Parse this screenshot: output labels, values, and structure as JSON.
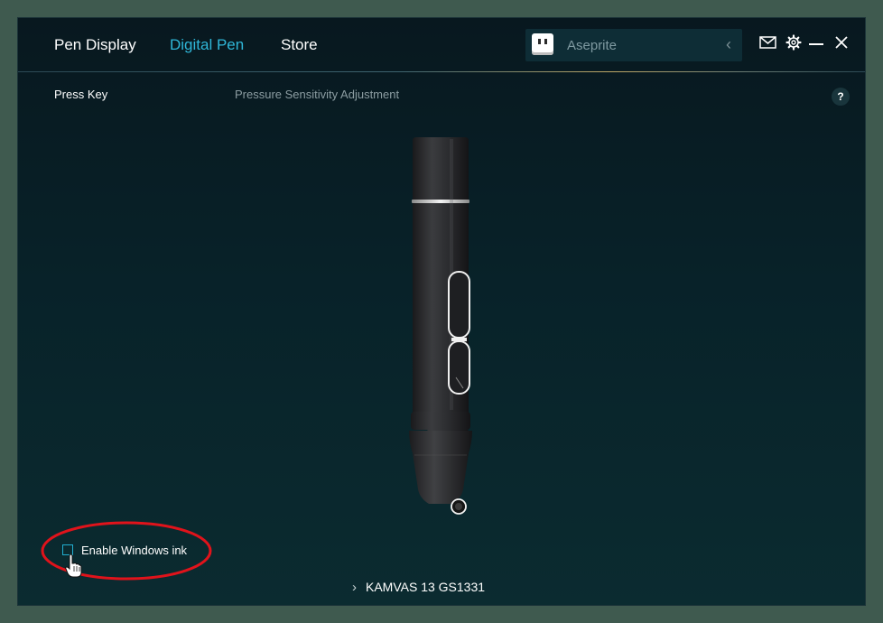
{
  "nav": {
    "tabs": [
      {
        "label": "Pen Display",
        "active": false
      },
      {
        "label": "Digital Pen",
        "active": true
      },
      {
        "label": "Store",
        "active": false
      }
    ]
  },
  "app_selector": {
    "value": "Aseprite",
    "icon": "aseprite-app-icon",
    "chevron": "‹"
  },
  "window_controls": [
    "mail-icon",
    "gear-icon",
    "minimize-icon",
    "close-icon"
  ],
  "subtabs": [
    {
      "label": "Press Key",
      "active": true
    },
    {
      "label": "Pressure Sensitivity Adjustment",
      "active": false
    }
  ],
  "help": {
    "label": "?"
  },
  "windows_ink": {
    "label": "Enable Windows ink",
    "checked": false
  },
  "device": {
    "chevron": "›",
    "name": "KAMVAS 13 GS1331"
  },
  "colors": {
    "accent": "#2fb7d9",
    "background": "#082229",
    "highlight": "#e0131b"
  }
}
